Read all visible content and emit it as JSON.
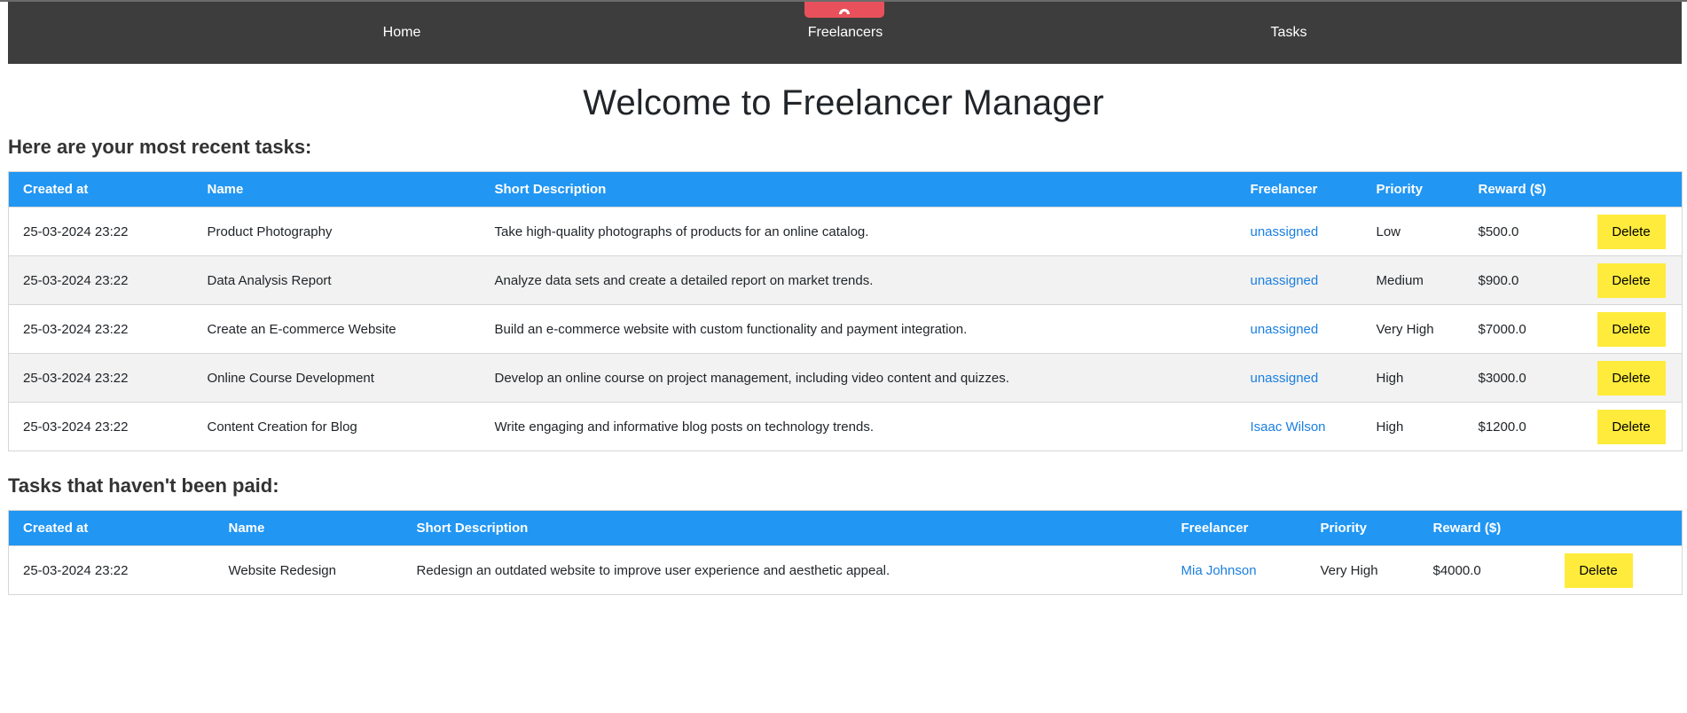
{
  "nav": {
    "items": [
      {
        "label": "Home"
      },
      {
        "label": "Freelancers"
      },
      {
        "label": "Tasks"
      }
    ],
    "brand_icon": "mountain-arch-icon",
    "brand_color": "#e8505b",
    "bar_color": "#3d3d3d"
  },
  "page": {
    "title": "Welcome to Freelancer Manager",
    "recent_heading": "Here are your most recent tasks:",
    "unpaid_heading": "Tasks that haven't been paid:"
  },
  "colors": {
    "table_header": "#2196f3",
    "delete_button": "#ffeb3b",
    "link": "#1a7fe0"
  },
  "recent_table": {
    "columns": [
      "Created at",
      "Name",
      "Short Description",
      "Freelancer",
      "Priority",
      "Reward ($)",
      ""
    ],
    "rows": [
      {
        "created": "25-03-2024 23:22",
        "name": "Product Photography",
        "description": "Take high-quality photographs of products for an online catalog.",
        "freelancer": "unassigned",
        "priority": "Low",
        "reward": "$500.0",
        "action": "Delete"
      },
      {
        "created": "25-03-2024 23:22",
        "name": "Data Analysis Report",
        "description": "Analyze data sets and create a detailed report on market trends.",
        "freelancer": "unassigned",
        "priority": "Medium",
        "reward": "$900.0",
        "action": "Delete"
      },
      {
        "created": "25-03-2024 23:22",
        "name": "Create an E-commerce Website",
        "description": "Build an e-commerce website with custom functionality and payment integration.",
        "freelancer": "unassigned",
        "priority": "Very High",
        "reward": "$7000.0",
        "action": "Delete"
      },
      {
        "created": "25-03-2024 23:22",
        "name": "Online Course Development",
        "description": "Develop an online course on project management, including video content and quizzes.",
        "freelancer": "unassigned",
        "priority": "High",
        "reward": "$3000.0",
        "action": "Delete"
      },
      {
        "created": "25-03-2024 23:22",
        "name": "Content Creation for Blog",
        "description": "Write engaging and informative blog posts on technology trends.",
        "freelancer": "Isaac Wilson",
        "priority": "High",
        "reward": "$1200.0",
        "action": "Delete"
      }
    ]
  },
  "unpaid_table": {
    "columns": [
      "Created at",
      "Name",
      "Short Description",
      "Freelancer",
      "Priority",
      "Reward ($)",
      ""
    ],
    "rows": [
      {
        "created": "25-03-2024 23:22",
        "name": "Website Redesign",
        "description": "Redesign an outdated website to improve user experience and aesthetic appeal.",
        "freelancer": "Mia Johnson",
        "priority": "Very High",
        "reward": "$4000.0",
        "action": "Delete"
      }
    ]
  }
}
